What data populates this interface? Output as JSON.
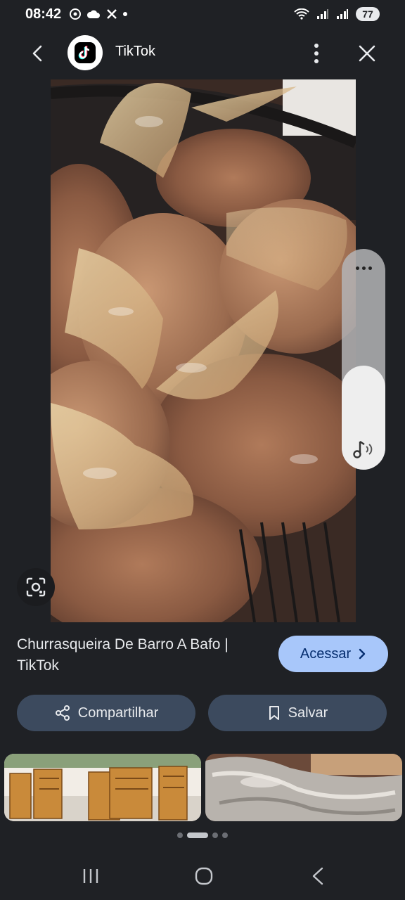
{
  "status_bar": {
    "time": "08:42",
    "battery": "77"
  },
  "header": {
    "title": "TikTok"
  },
  "result": {
    "title": "Churrasqueira De Barro A Bafo | TikTok",
    "visit_label": "Acessar",
    "share_label": "Compartilhar",
    "save_label": "Salvar"
  },
  "carousel": {
    "page_count": 4,
    "active_index": 0
  },
  "volume": {
    "level": 0.47
  },
  "colors": {
    "background": "#1f2125",
    "accent": "#a8c7fa",
    "button_bg": "#3c4a5e"
  },
  "icons": {
    "back": "arrow-left-icon",
    "more": "more-vert-icon",
    "close": "close-icon",
    "lens": "google-lens-icon",
    "share": "share-icon",
    "save": "bookmark-icon",
    "visit": "chevron-right-icon",
    "volume": "music-note-icon"
  }
}
